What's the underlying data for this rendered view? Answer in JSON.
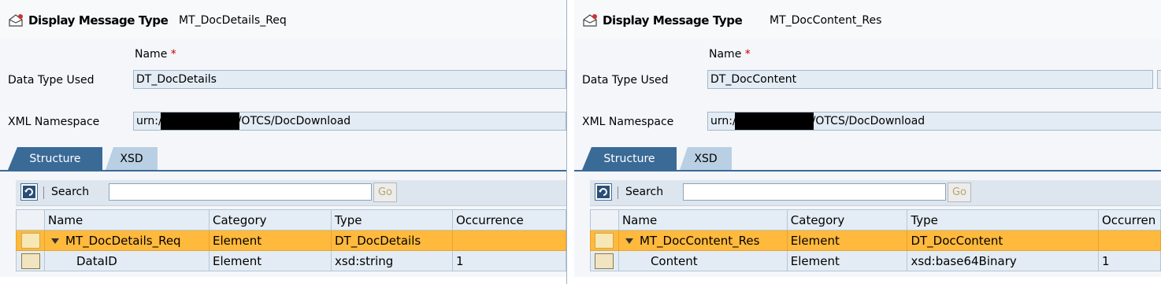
{
  "left": {
    "title_label": "Display Message Type",
    "title_value": "MT_DocDetails_Req",
    "name_label": "Name",
    "required_mark": "*",
    "data_type_label": "Data Type Used",
    "data_type_value": "DT_DocDetails",
    "xml_ns_label": "XML Namespace",
    "xml_ns_prefix": "urn:/",
    "xml_ns_suffix": "/OTCS/DocDownload",
    "tabs": [
      {
        "label": "Structure"
      },
      {
        "label": "XSD"
      }
    ],
    "search_label": "Search",
    "search_value": "",
    "go_label": "Go",
    "columns": [
      "Name",
      "Category",
      "Type",
      "Occurrence"
    ],
    "rows": [
      {
        "name": "MT_DocDetails_Req",
        "category": "Element",
        "type": "DT_DocDetails",
        "occurrence": ""
      },
      {
        "name": "DataID",
        "category": "Element",
        "type": "xsd:string",
        "occurrence": "1"
      }
    ]
  },
  "right": {
    "title_label": "Display Message Type",
    "title_value": "MT_DocContent_Res",
    "name_label": "Name",
    "required_mark": "*",
    "data_type_label": "Data Type Used",
    "data_type_value": "DT_DocContent",
    "xml_ns_label": "XML Namespace",
    "xml_ns_prefix": "urn:/",
    "xml_ns_suffix": "/OTCS/DocDownload",
    "tabs": [
      {
        "label": "Structure"
      },
      {
        "label": "XSD"
      }
    ],
    "search_label": "Search",
    "search_value": "",
    "go_label": "Go",
    "columns": [
      "Name",
      "Category",
      "Type",
      "Occurren"
    ],
    "rows": [
      {
        "name": "MT_DocContent_Res",
        "category": "Element",
        "type": "DT_DocContent",
        "occurrence": ""
      },
      {
        "name": "Content",
        "category": "Element",
        "type": "xsd:base64Binary",
        "occurrence": "1"
      }
    ]
  },
  "colors": {
    "tab_active": "#3a6a96",
    "tab_inactive": "#b9cfe3",
    "row_selected": "#ffb93c",
    "field_bg": "#e3ecf4"
  }
}
